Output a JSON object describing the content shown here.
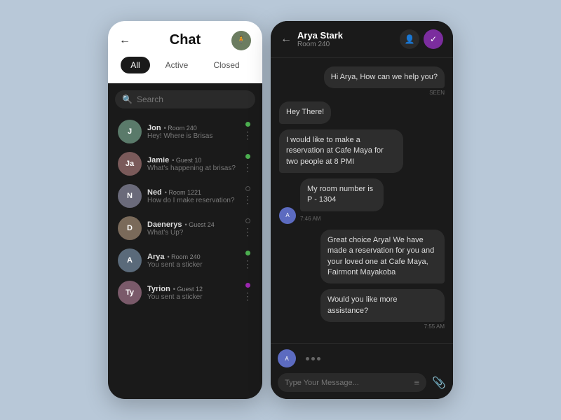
{
  "app": {
    "background_color": "#b8c8d8"
  },
  "left_panel": {
    "title": "Chat",
    "back_label": "←",
    "filter_tabs": [
      {
        "label": "All",
        "active": true
      },
      {
        "label": "Active",
        "active": false
      },
      {
        "label": "Closed",
        "active": false
      }
    ],
    "search_placeholder": "Search",
    "chat_list": [
      {
        "name": "Jon",
        "room": "Room 240",
        "preview": "Hey! Where is Brisas",
        "avatar_color": "#5a7a6a",
        "avatar_initials": "J",
        "status": "green"
      },
      {
        "name": "Jamie",
        "room": "Guest 10",
        "preview": "What's happening at brisas?",
        "avatar_color": "#7a5a5a",
        "avatar_initials": "Ja",
        "status": "green"
      },
      {
        "name": "Ned",
        "room": "Room 1221",
        "preview": "How do I make reservation?",
        "avatar_color": "#6a6a7a",
        "avatar_initials": "N",
        "status": "gray"
      },
      {
        "name": "Daenerys",
        "room": "Guest 24",
        "preview": "What's Up?",
        "avatar_color": "#7a6a5a",
        "avatar_initials": "D",
        "status": "gray"
      },
      {
        "name": "Arya",
        "room": "Room 240",
        "preview": "You sent a sticker",
        "avatar_color": "#5a6a7a",
        "avatar_initials": "A",
        "status": "green"
      },
      {
        "name": "Tyrion",
        "room": "Guest 12",
        "preview": "You sent a sticker",
        "avatar_color": "#7a5a6a",
        "avatar_initials": "Ty",
        "status": "purple"
      }
    ]
  },
  "right_panel": {
    "contact_name": "Arya Stark",
    "contact_room": "Room 240",
    "back_label": "←",
    "messages": [
      {
        "id": 1,
        "type": "outgoing",
        "text": "Hi Arya, How can we help you?",
        "seen": "SEEN"
      },
      {
        "id": 2,
        "type": "incoming",
        "text": "Hey There!",
        "seen": null
      },
      {
        "id": 3,
        "type": "incoming",
        "text": "I would like to make a reservation at Cafe Maya for two people at 8 PMI",
        "seen": null
      },
      {
        "id": 4,
        "type": "incoming_avatar",
        "text": "My room number is P - 1304",
        "time": "7:46 AM",
        "seen": null
      },
      {
        "id": 5,
        "type": "outgoing",
        "text": "Great choice Arya! We have made a reservation for you and your loved one at Cafe Maya, Fairmont Mayakoba",
        "seen": null
      },
      {
        "id": 6,
        "type": "outgoing",
        "text": "Would you like more assistance?",
        "time": "7:55 AM",
        "seen": null
      }
    ],
    "input_placeholder": "Type Your Message...",
    "typing_avatar_initials": "A"
  }
}
